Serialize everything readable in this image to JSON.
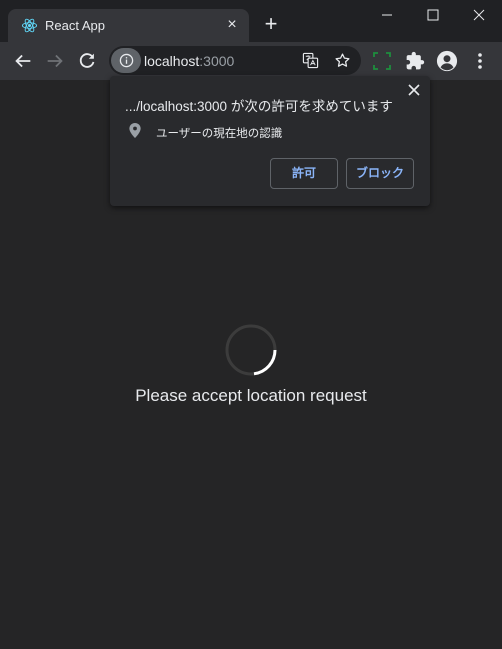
{
  "tab": {
    "title": "React App",
    "favicon": "react-logo-icon",
    "close": "×"
  },
  "new_tab": "+",
  "omnibox": {
    "host": "localhost",
    "port": ":3000"
  },
  "permission_prompt": {
    "title": ".../localhost:3000 が次の許可を求めています",
    "permission_label": "ユーザーの現在地の認識",
    "allow_label": "許可",
    "block_label": "ブロック"
  },
  "page": {
    "message": "Please accept location request"
  },
  "colors": {
    "accent": "#8ab4f8",
    "extension_green": "#1e8e3e",
    "page_bg": "#252526"
  }
}
